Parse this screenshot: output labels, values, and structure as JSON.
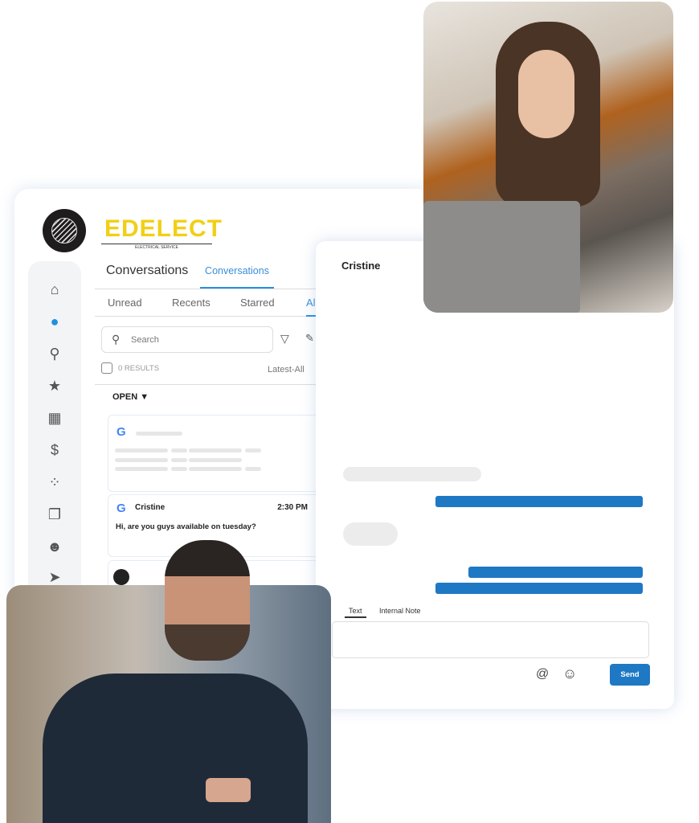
{
  "brand": {
    "name": "EDELECT",
    "tagline": "ELECTRICAL SERVICE"
  },
  "sidebar": {
    "icons": [
      "home-icon",
      "chat-icon",
      "location-pin-icon",
      "star-icon",
      "grid-icon",
      "dollar-icon",
      "apps-icon",
      "layers-icon",
      "users-icon",
      "send-icon"
    ]
  },
  "header": {
    "title": "Conversations",
    "active_tab": "Conversations"
  },
  "filters": [
    "Unread",
    "Recents",
    "Starred",
    "All"
  ],
  "search": {
    "placeholder": "Search"
  },
  "results": {
    "count": "0 RESULTS",
    "sort": "Latest-All"
  },
  "section": "OPEN",
  "conversation": {
    "name": "Cristine",
    "time": "2:30 PM",
    "message": "Hi, are you guys available on tuesday?"
  },
  "chat": {
    "contact": "Cristine",
    "tabs": [
      "Text",
      "Internal Note"
    ],
    "send": "Send"
  },
  "colors": {
    "accent": "#1f78c4",
    "brand": "#f2cf16"
  }
}
